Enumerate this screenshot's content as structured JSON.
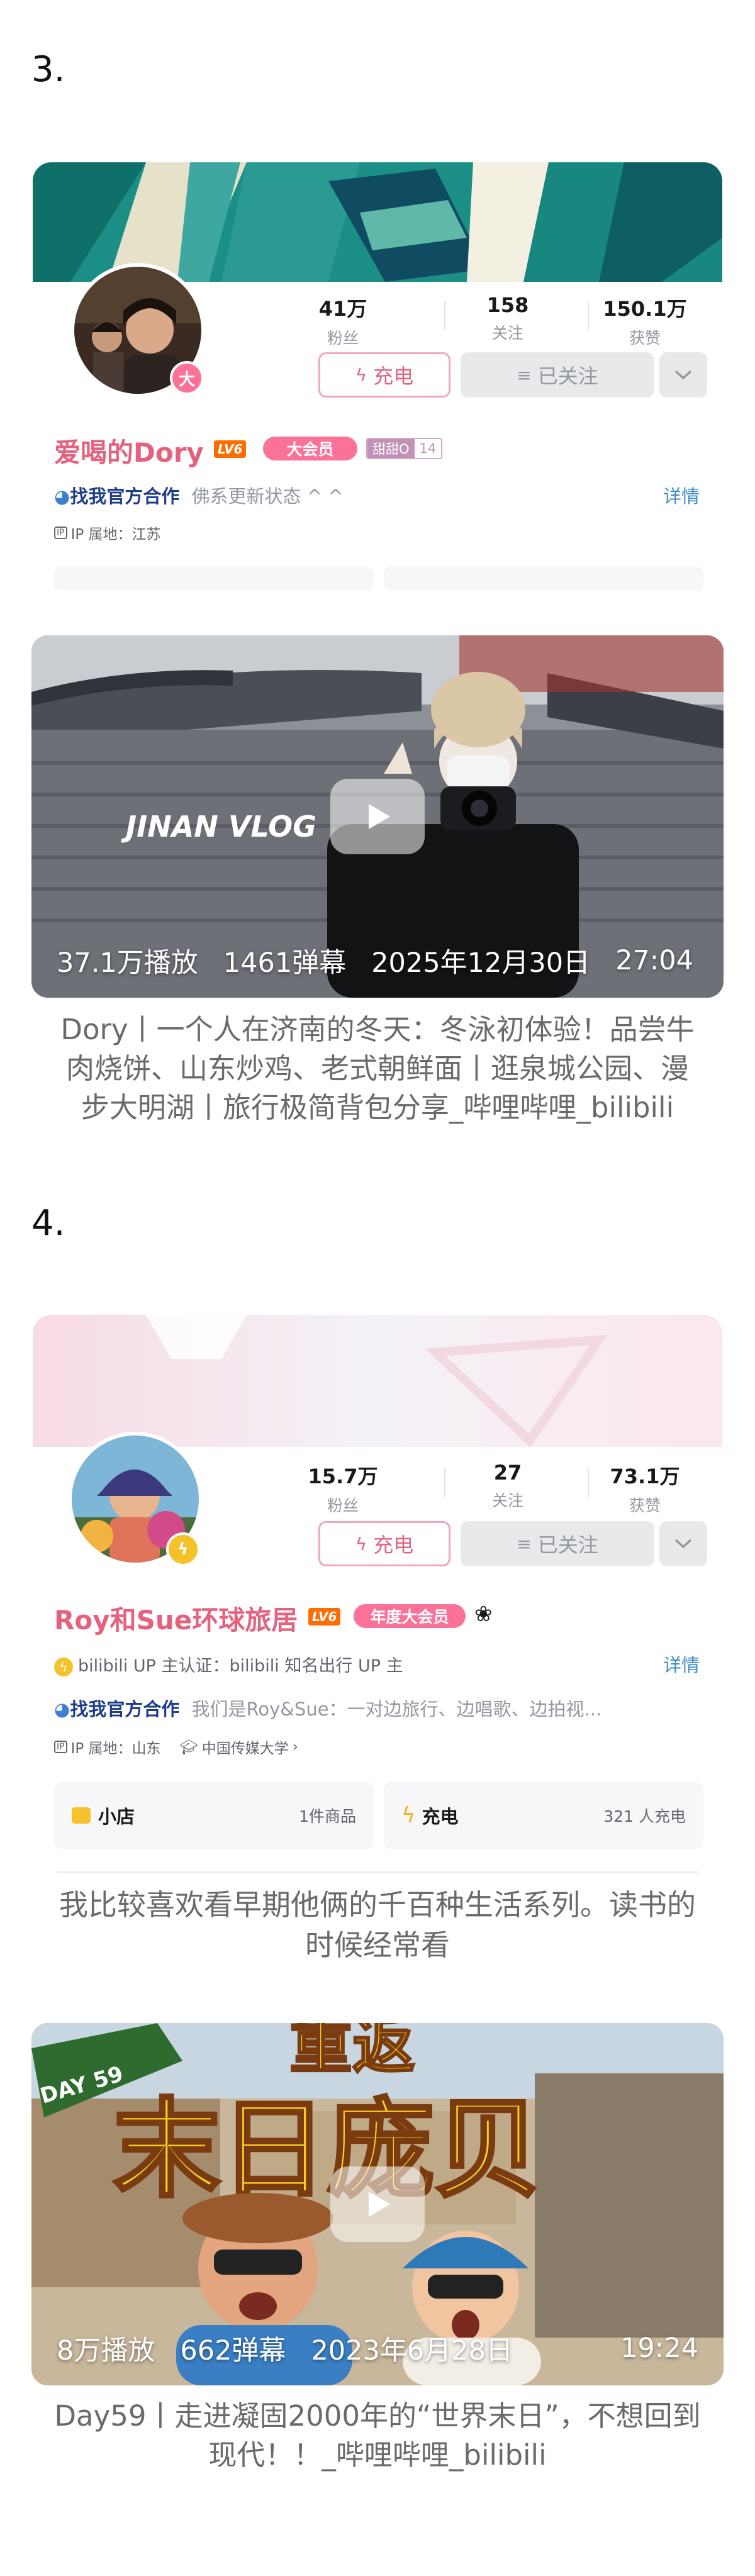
{
  "sections": [
    {
      "number": "3.",
      "profile": {
        "avatar_badge": "大",
        "stats": [
          {
            "value": "41万",
            "label": "粉丝"
          },
          {
            "value": "158",
            "label": "关注"
          },
          {
            "value": "150.1万",
            "label": "获赞"
          }
        ],
        "charge_label": "充电",
        "follow_label": "已关注",
        "name": "爱喝的Dory",
        "level": "LV6",
        "vip": "大会员",
        "fan_badge_name": "甜甜O",
        "fan_badge_level": "14",
        "official_partner": "找我官方合作",
        "signature": "佛系更新状态 ^ ^",
        "detail_link": "详情",
        "ip_location": "IP 属地：江苏"
      },
      "video": {
        "overlay_text": "JINAN VLOG",
        "plays": "37.1万播放",
        "danmaku": "1461弹幕",
        "date": "2025年12月30日",
        "duration": "27:04"
      },
      "caption_lines": [
        "Dory丨一个人在济南的冬天：冬泳初体验！品尝牛",
        "肉烧饼、山东炒鸡、老式朝鲜面丨逛泉城公园、漫",
        "步大明湖丨旅行极简背包分享_哔哩哔哩_bilibili"
      ]
    },
    {
      "number": "4.",
      "profile": {
        "stats": [
          {
            "value": "15.7万",
            "label": "粉丝"
          },
          {
            "value": "27",
            "label": "关注"
          },
          {
            "value": "73.1万",
            "label": "获赞"
          }
        ],
        "charge_label": "充电",
        "follow_label": "已关注",
        "name": "Roy和Sue环球旅居",
        "level": "LV6",
        "vip": "年度大会员",
        "certification": "bilibili UP 主认证：bilibili 知名出行 UP 主",
        "official_partner": "找我官方合作",
        "signature": "我们是Roy&Sue：一对边旅行、边唱歌、边拍视...",
        "detail_link": "详情",
        "ip_location": "IP 属地：山东",
        "school": "中国传媒大学",
        "shop_label": "小店",
        "shop_count": "1件商品",
        "charge_box_label": "充电",
        "charge_box_count": "321 人充电"
      },
      "comment_lines": [
        "我比较喜欢看早期他俩的千百种生活系列。读书的",
        "时候经常看"
      ],
      "video": {
        "title_top": "重返",
        "title_main": "末日庞贝",
        "day_tag": "DAY 59",
        "plays": "8万播放",
        "danmaku": "662弹幕",
        "date": "2023年6月28日",
        "duration": "19:24"
      },
      "caption_lines": [
        "Day59丨走进凝固2000年的“世界末日”，不想回到",
        "现代！！_哔哩哔哩_bilibili"
      ]
    }
  ]
}
